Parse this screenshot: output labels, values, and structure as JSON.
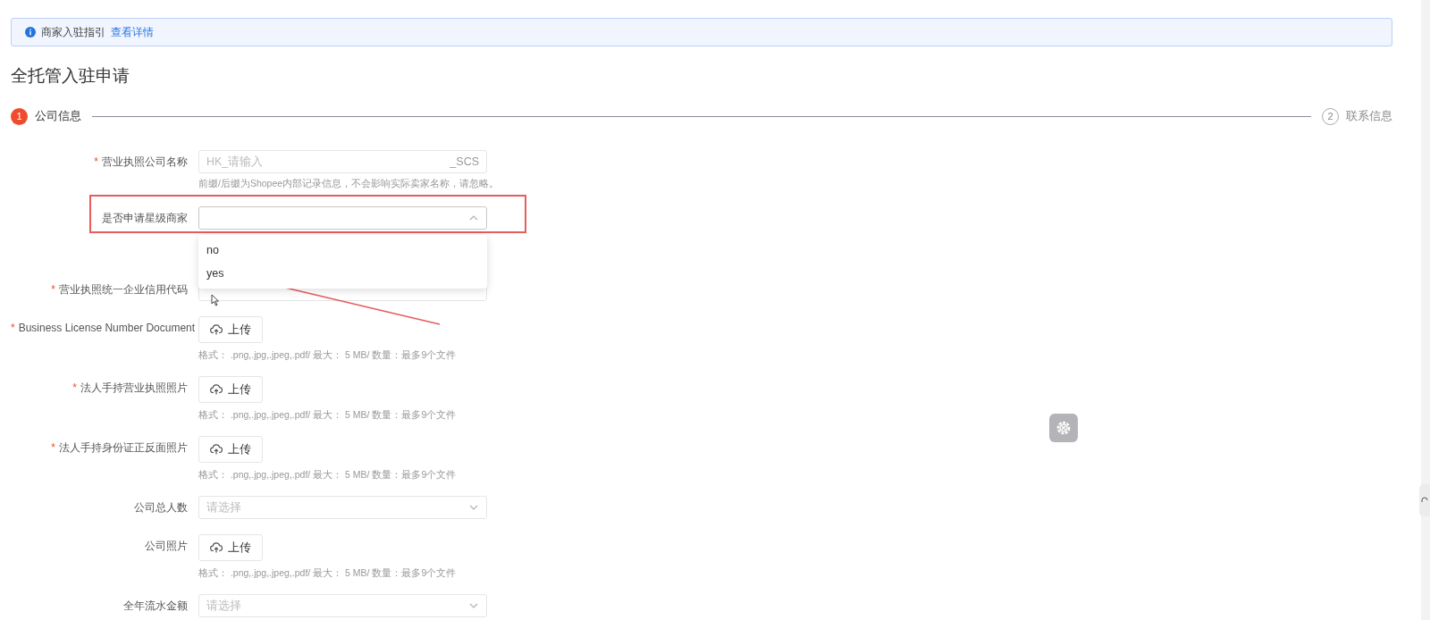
{
  "notice": {
    "text": "商家入驻指引",
    "link": "查看详情"
  },
  "title": "全托管入驻申请",
  "steps": [
    {
      "number": "1",
      "label": "公司信息",
      "selected": true
    },
    {
      "number": "2",
      "label": "联系信息",
      "selected": false
    }
  ],
  "fields": [
    {
      "kind": "text",
      "label": "营业执照公司名称",
      "required_mark": "*",
      "placeholder": "HK_请输入",
      "suffix": "_SCS",
      "hint": "前缀/后缀为Shopee内部记录信息，不会影响实际卖家名称，请忽略。"
    },
    {
      "kind": "select",
      "label": "是否申请星级商家",
      "highlighted": true,
      "expanded": true,
      "options": [
        {
          "label": "no",
          "selected": false
        },
        {
          "label": "yes",
          "selected": false
        }
      ]
    },
    {
      "kind": "text",
      "label": "营业执照统一企业信用代码",
      "required_mark": "*"
    },
    {
      "kind": "upload",
      "label": "Business License Number Document",
      "required_mark": "*",
      "button": "上传",
      "hint": "格式： .png,.jpg,.jpeg,.pdf/ 最大： 5 MB/ 数量：最多9个文件"
    },
    {
      "kind": "upload",
      "label": "法人手持营业执照照片",
      "required_mark": "*",
      "button": "上传",
      "hint": "格式： .png,.jpg,.jpeg,.pdf/ 最大： 5 MB/ 数量：最多9个文件"
    },
    {
      "kind": "upload",
      "label": "法人手持身份证正反面照片",
      "required_mark": "*",
      "button": "上传",
      "hint": "格式： .png,.jpg,.jpeg,.pdf/ 最大： 5 MB/ 数量：最多9个文件"
    },
    {
      "kind": "select",
      "label": "公司总人数",
      "placeholder": "请选择",
      "expanded": false
    },
    {
      "kind": "upload",
      "label": "公司照片",
      "button": "上传",
      "hint": "格式： .png,.jpg,.jpeg,.pdf/ 最大： 5 MB/ 数量：最多9个文件"
    },
    {
      "kind": "select",
      "label": "全年流水金额",
      "placeholder": "请选择",
      "expanded": false
    }
  ]
}
